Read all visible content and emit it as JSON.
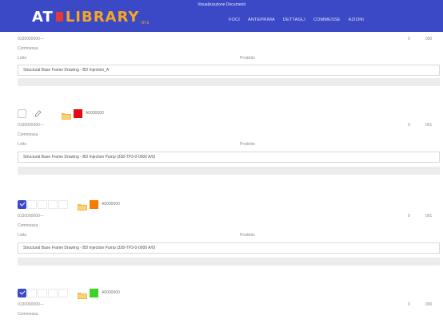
{
  "header": {
    "logo_at": "AT",
    "logo_library": "LIBRARY",
    "logo_sub": "ms",
    "title": "Visualizzazione Documenti",
    "nav": [
      "FOCI",
      "ANTEPRIMA",
      "DETTAGLI",
      "COMMESSE",
      "AZIONI"
    ]
  },
  "labels": {
    "commessa": "Commessa",
    "lotto": "Lotto",
    "prodotto": "Prodotto"
  },
  "records": [
    {
      "code": "0130000000—",
      "r1": "0",
      "r2": "000",
      "description": "Structural Base Frame Drawing - BD Injection_A"
    },
    {
      "tag": "A0000000",
      "tag_color": "#e50914",
      "checked": false,
      "code": "0130000000—",
      "r1": "0",
      "r2": "001",
      "description": "Structural Base Frame Drawing - BD Injection Pump (338-TP3-0-0000 A/0)"
    },
    {
      "tag": "A0000000",
      "tag_color": "#f57c00",
      "checked": true,
      "code": "0130000000—",
      "r1": "0",
      "r2": "001",
      "description": "Structural Base Frame Drawing - BD Injection Pump (338-TP3-0-0000 A/0)"
    },
    {
      "tag": "A0000000",
      "tag_color": "#39d427",
      "checked": true,
      "code": "0130000000—",
      "r1": "0",
      "r2": "000"
    }
  ]
}
